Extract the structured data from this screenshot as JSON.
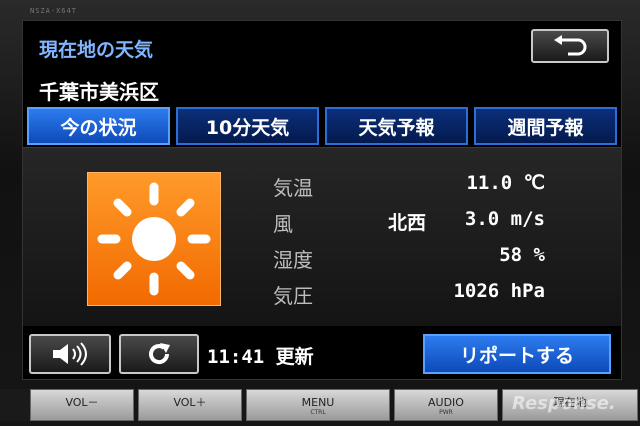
{
  "device": {
    "model": "NSZA-X64T"
  },
  "header": {
    "title": "現在地の天気",
    "location": "千葉市美浜区",
    "back_icon": "return-arrow-icon"
  },
  "tabs": [
    {
      "label": "今の状況",
      "active": true
    },
    {
      "label": "10分天気",
      "active": false
    },
    {
      "label": "天気予報",
      "active": false
    },
    {
      "label": "週間予報",
      "active": false
    }
  ],
  "weather": {
    "icon": "sunny-icon",
    "rows": [
      {
        "label": "気温",
        "direction": "",
        "value": "11.0 ℃"
      },
      {
        "label": "風",
        "direction": "北西",
        "value": "3.0 m/s"
      },
      {
        "label": "湿度",
        "direction": "",
        "value": "58 %"
      },
      {
        "label": "気圧",
        "direction": "",
        "value": "1026 hPa"
      }
    ]
  },
  "footer": {
    "volume_icon": "speaker-icon",
    "refresh_icon": "refresh-icon",
    "updated": "11:41 更新",
    "report_label": "リポートする"
  },
  "hardware": [
    {
      "main": "VOL－",
      "sub": ""
    },
    {
      "main": "VOL＋",
      "sub": ""
    },
    {
      "main": "MENU",
      "sub": "CTRL"
    },
    {
      "main": "AUDIO",
      "sub": "PWR"
    },
    {
      "main": "現在地",
      "sub": ""
    }
  ],
  "watermark": "Response.",
  "colors": {
    "accent": "#2d7cf0",
    "title": "#7fb6ff",
    "sun": "#f26a00"
  }
}
